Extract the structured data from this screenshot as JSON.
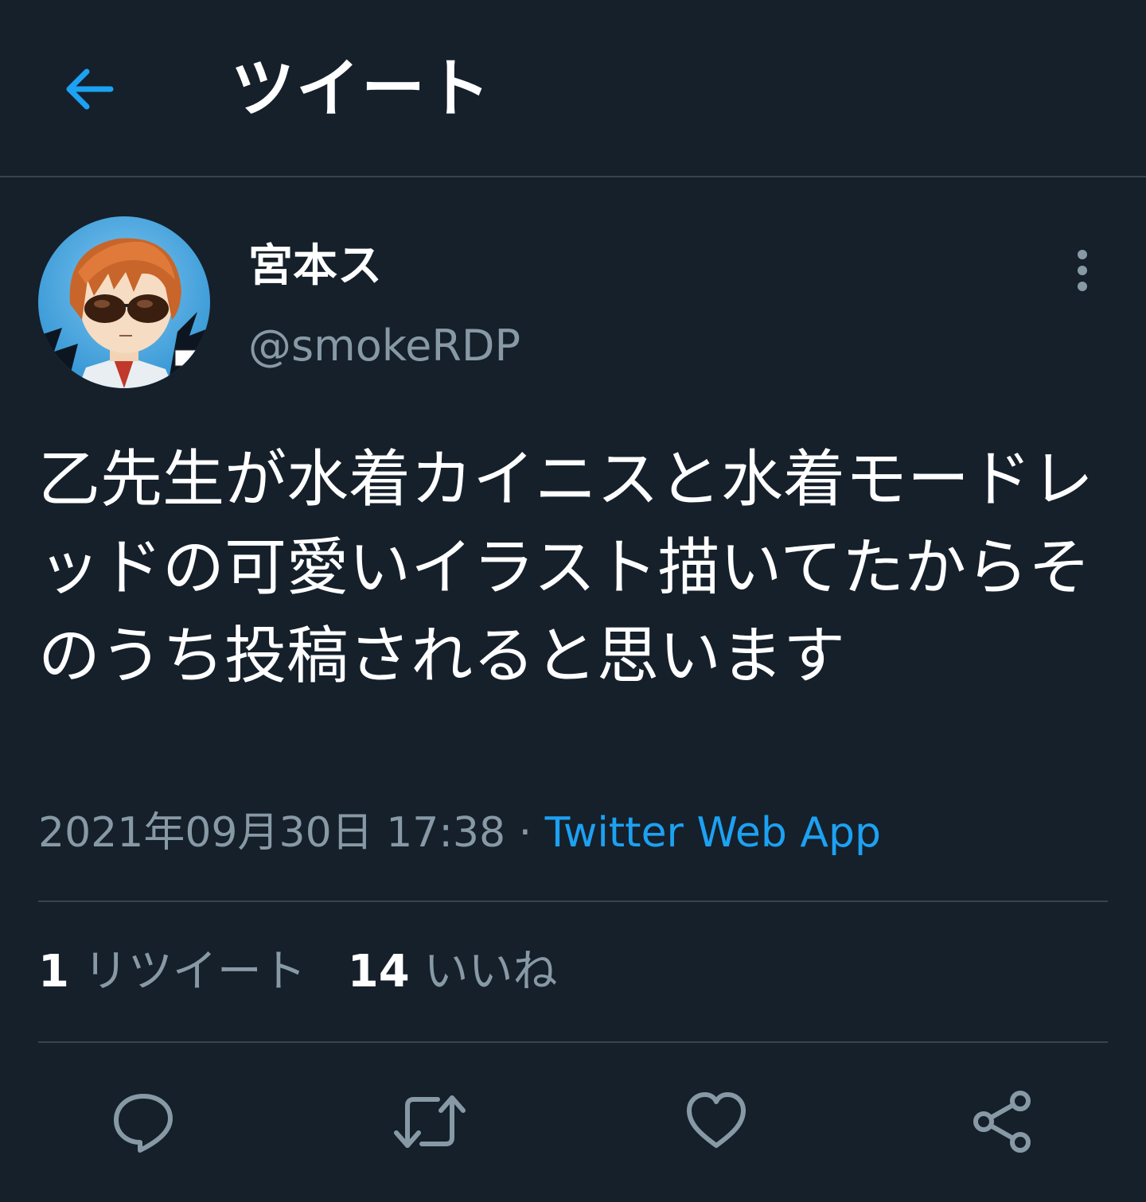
{
  "header": {
    "back_icon": "arrow-left-icon",
    "title": "ツイート"
  },
  "tweet": {
    "author": {
      "display_name": "宮本ス",
      "handle": "@smokeRDP"
    },
    "more_icon": "more-vertical-icon",
    "text": "乙先生が水着カイニスと水着モードレッドの可愛いイラスト描いてたからそのうち投稿されると思います",
    "timestamp": "2021年09月30日 17:38",
    "separator": " · ",
    "source": "Twitter Web App"
  },
  "stats": {
    "retweets": {
      "count": "1",
      "label": "リツイート"
    },
    "likes": {
      "count": "14",
      "label": "いいね"
    }
  },
  "actions": [
    {
      "name": "reply",
      "icon": "reply-icon"
    },
    {
      "name": "retweet",
      "icon": "retweet-icon"
    },
    {
      "name": "like",
      "icon": "heart-icon"
    },
    {
      "name": "share",
      "icon": "share-icon"
    }
  ],
  "colors": {
    "background": "#15202b",
    "divider": "#38444d",
    "secondary_text": "#8899a6",
    "accent": "#1da1f2",
    "primary_text": "#ffffff"
  }
}
